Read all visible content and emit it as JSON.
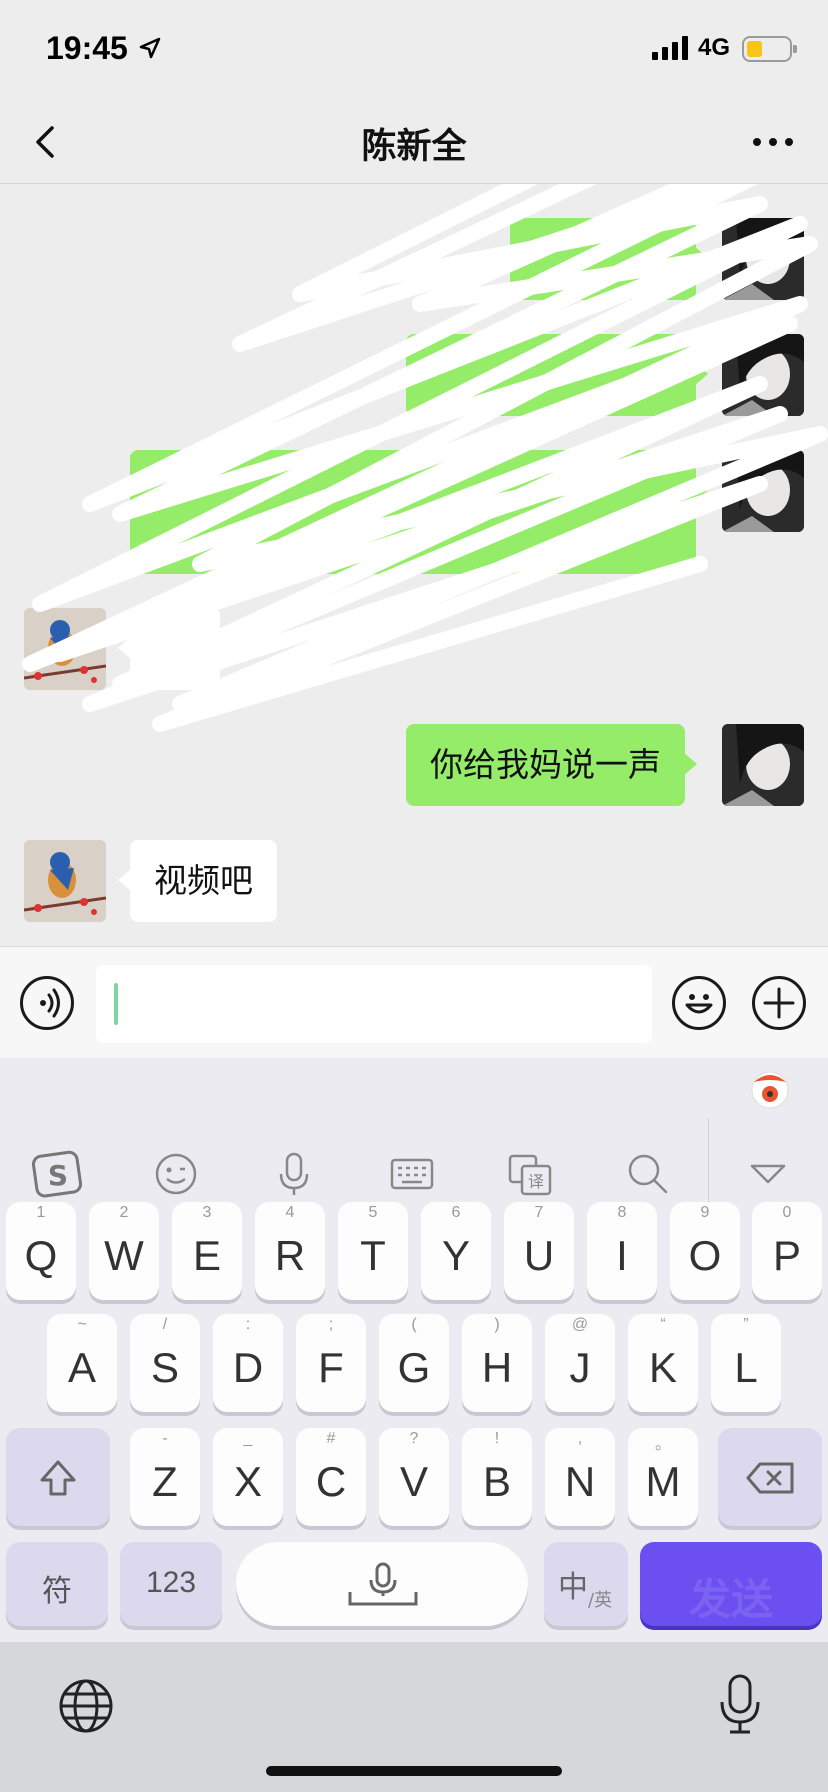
{
  "status": {
    "time": "19:45",
    "network": "4G"
  },
  "header": {
    "title": "陈新全"
  },
  "messages": [
    {
      "side": "me",
      "text": "你给我妈说一声"
    },
    {
      "side": "them",
      "text": "视频吧"
    }
  ],
  "input": {
    "value": ""
  },
  "keyboard": {
    "row1": [
      {
        "key": "Q",
        "hint": "1"
      },
      {
        "key": "W",
        "hint": "2"
      },
      {
        "key": "E",
        "hint": "3"
      },
      {
        "key": "R",
        "hint": "4"
      },
      {
        "key": "T",
        "hint": "5"
      },
      {
        "key": "Y",
        "hint": "6"
      },
      {
        "key": "U",
        "hint": "7"
      },
      {
        "key": "I",
        "hint": "8"
      },
      {
        "key": "O",
        "hint": "9"
      },
      {
        "key": "P",
        "hint": "0"
      }
    ],
    "row2": [
      {
        "key": "A",
        "hint": "~"
      },
      {
        "key": "S",
        "hint": "/"
      },
      {
        "key": "D",
        "hint": ":"
      },
      {
        "key": "F",
        "hint": ";"
      },
      {
        "key": "G",
        "hint": "("
      },
      {
        "key": "H",
        "hint": ")"
      },
      {
        "key": "J",
        "hint": "@"
      },
      {
        "key": "K",
        "hint": "“"
      },
      {
        "key": "L",
        "hint": "”"
      }
    ],
    "row3": [
      {
        "key": "Z",
        "hint": "-"
      },
      {
        "key": "X",
        "hint": "_"
      },
      {
        "key": "C",
        "hint": "#"
      },
      {
        "key": "V",
        "hint": "?"
      },
      {
        "key": "B",
        "hint": "!"
      },
      {
        "key": "N",
        "hint": ","
      },
      {
        "key": "M",
        "hint": "。"
      }
    ],
    "symbol_key": "符",
    "number_key": "123",
    "lang_key_main": "中",
    "lang_key_sub": "/英",
    "send_key": "发送"
  }
}
